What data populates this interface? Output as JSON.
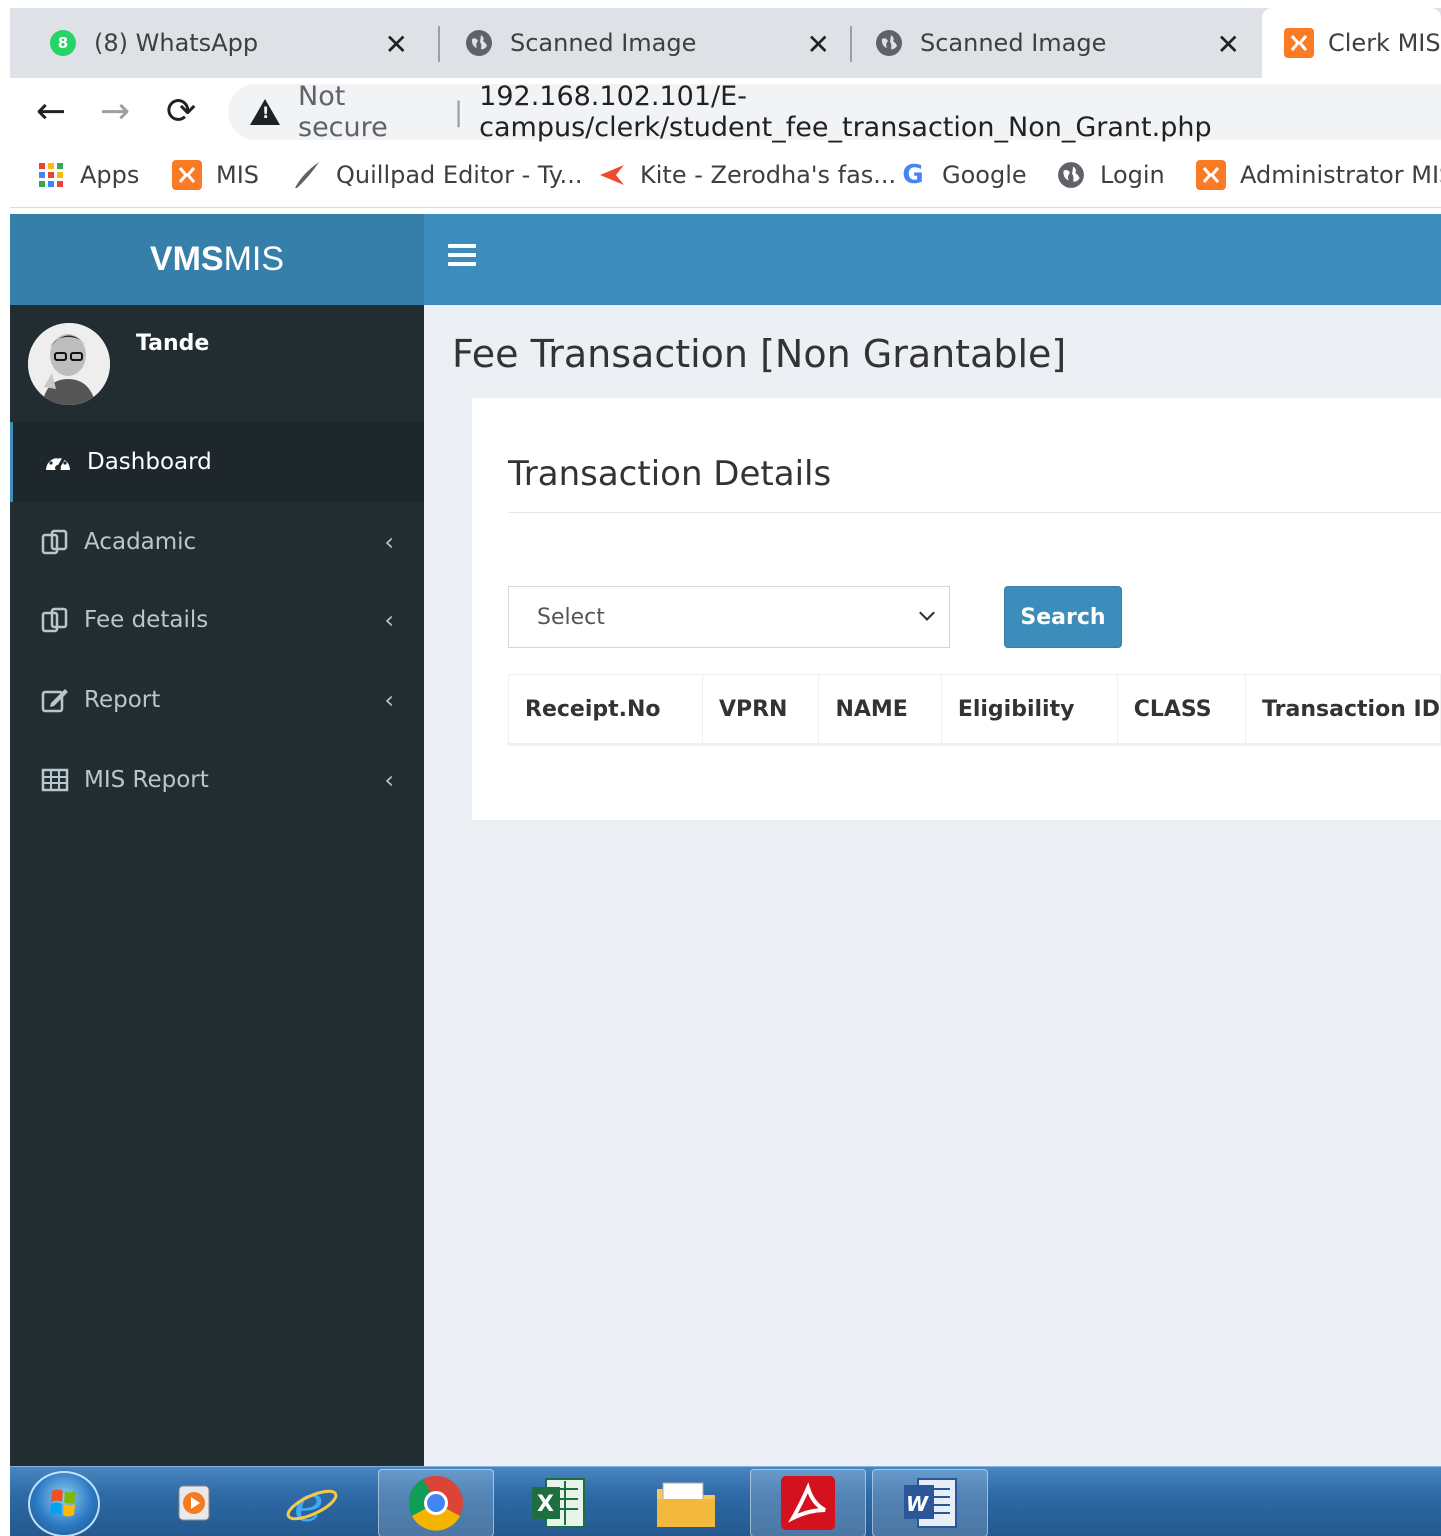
{
  "browser": {
    "tabs": [
      {
        "title": "(8) WhatsApp",
        "badge": "8",
        "icon": "whatsapp-icon"
      },
      {
        "title": "Scanned Image",
        "icon": "globe-icon"
      },
      {
        "title": "Scanned Image",
        "icon": "globe-icon"
      },
      {
        "title": "Clerk MIS",
        "icon": "xampp-icon"
      }
    ],
    "close_glyph": "✕",
    "nav": {
      "back": "←",
      "forward": "→",
      "reload": "⟳"
    },
    "address": {
      "security": "Not secure",
      "url": "192.168.102.101/E-campus/clerk/student_fee_transaction_Non_Grant.php"
    },
    "bookmarks": [
      {
        "label": "Apps",
        "icon": "apps-grid-icon"
      },
      {
        "label": "MIS",
        "icon": "xampp-icon"
      },
      {
        "label": "Quillpad Editor - Ty...",
        "icon": "quill-icon"
      },
      {
        "label": "Kite - Zerodha's fas...",
        "icon": "kite-icon"
      },
      {
        "label": "Google",
        "icon": "google-icon"
      },
      {
        "label": "Login",
        "icon": "globe-icon"
      },
      {
        "label": "Administrator MIS",
        "icon": "xampp-icon"
      }
    ]
  },
  "app": {
    "logo_bold": "VMS",
    "logo_light": "MIS",
    "user": {
      "name": "Tande"
    },
    "sidebar": [
      {
        "label": "Dashboard",
        "icon": "dashboard-icon",
        "active": true
      },
      {
        "label": "Acadamic",
        "icon": "copy-icon"
      },
      {
        "label": "Fee details",
        "icon": "copy-icon"
      },
      {
        "label": "Report",
        "icon": "edit-icon"
      },
      {
        "label": "MIS Report",
        "icon": "table-icon"
      }
    ],
    "chevron": "‹",
    "page_title": "Fee Transaction [Non Grantable]",
    "box_title": "Transaction Details",
    "select_value": "Select",
    "search_label": "Search",
    "table_headers": [
      "Receipt.No",
      "VPRN",
      "NAME",
      "Eligibility",
      "CLASS",
      "Transaction ID"
    ]
  },
  "colors": {
    "header_dark": "#367fa9",
    "header": "#3c8dbc",
    "sidebar": "#222d32",
    "content_bg": "#ecf0f5"
  },
  "taskbar": {
    "items": [
      "windows-start-icon",
      "media-player-icon",
      "internet-explorer-icon",
      "chrome-icon",
      "excel-icon",
      "file-explorer-icon",
      "acrobat-icon",
      "word-icon"
    ]
  }
}
